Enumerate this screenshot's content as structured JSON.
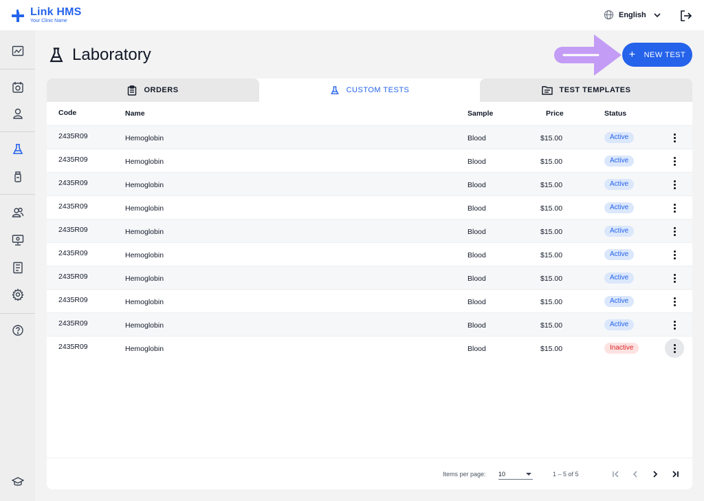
{
  "app": {
    "name": "Link HMS",
    "subtitle": "Your Clinic Name"
  },
  "header": {
    "language": "English",
    "icons": [
      "globe-icon",
      "chevron-down-icon",
      "logout-icon"
    ]
  },
  "sidebar": {
    "items": [
      {
        "name": "dashboard",
        "icon": "chart-icon"
      },
      {
        "name": "appointments",
        "icon": "calendar-icon"
      },
      {
        "name": "patients",
        "icon": "user-icon"
      },
      {
        "name": "laboratory",
        "icon": "flask-icon",
        "active": true
      },
      {
        "name": "pharmacy",
        "icon": "bottle-icon"
      },
      {
        "name": "staff",
        "icon": "users-icon"
      },
      {
        "name": "monitor",
        "icon": "monitor-icon"
      },
      {
        "name": "reports",
        "icon": "report-icon"
      },
      {
        "name": "settings",
        "icon": "gear-icon"
      },
      {
        "name": "help",
        "icon": "help-icon"
      },
      {
        "name": "learn",
        "icon": "graduation-icon"
      }
    ]
  },
  "page": {
    "title": "Laboratory",
    "new_button": "NEW TEST"
  },
  "tabs": [
    {
      "label": "ORDERS",
      "icon": "clipboard-icon",
      "active": false
    },
    {
      "label": "CUSTOM TESTS",
      "icon": "flask-icon",
      "active": true
    },
    {
      "label": "TEST TEMPLATES",
      "icon": "folder-icon",
      "active": false
    }
  ],
  "table": {
    "columns": [
      "Code",
      "Name",
      "Sample",
      "Price",
      "Status"
    ],
    "rows": [
      {
        "code": "2435R09",
        "name": "Hemoglobin",
        "sample": "Blood",
        "price": "$15.00",
        "status": "Active"
      },
      {
        "code": "2435R09",
        "name": "Hemoglobin",
        "sample": "Blood",
        "price": "$15.00",
        "status": "Active"
      },
      {
        "code": "2435R09",
        "name": "Hemoglobin",
        "sample": "Blood",
        "price": "$15.00",
        "status": "Active"
      },
      {
        "code": "2435R09",
        "name": "Hemoglobin",
        "sample": "Blood",
        "price": "$15.00",
        "status": "Active"
      },
      {
        "code": "2435R09",
        "name": "Hemoglobin",
        "sample": "Blood",
        "price": "$15.00",
        "status": "Active"
      },
      {
        "code": "2435R09",
        "name": "Hemoglobin",
        "sample": "Blood",
        "price": "$15.00",
        "status": "Active"
      },
      {
        "code": "2435R09",
        "name": "Hemoglobin",
        "sample": "Blood",
        "price": "$15.00",
        "status": "Active"
      },
      {
        "code": "2435R09",
        "name": "Hemoglobin",
        "sample": "Blood",
        "price": "$15.00",
        "status": "Active"
      },
      {
        "code": "2435R09",
        "name": "Hemoglobin",
        "sample": "Blood",
        "price": "$15.00",
        "status": "Active"
      },
      {
        "code": "2435R09",
        "name": "Hemoglobin",
        "sample": "Blood",
        "price": "$15.00",
        "status": "Inactive"
      }
    ]
  },
  "pagination": {
    "items_per_page_label": "Items per page:",
    "items_per_page_value": "10",
    "range": "1 – 5 of 5"
  },
  "colors": {
    "accent": "#2563eb",
    "annotation_arrow": "#c39cf5",
    "active_badge_bg": "#dbe7fb",
    "inactive_badge_bg": "#fde2e2",
    "inactive_text": "#dc2626"
  }
}
